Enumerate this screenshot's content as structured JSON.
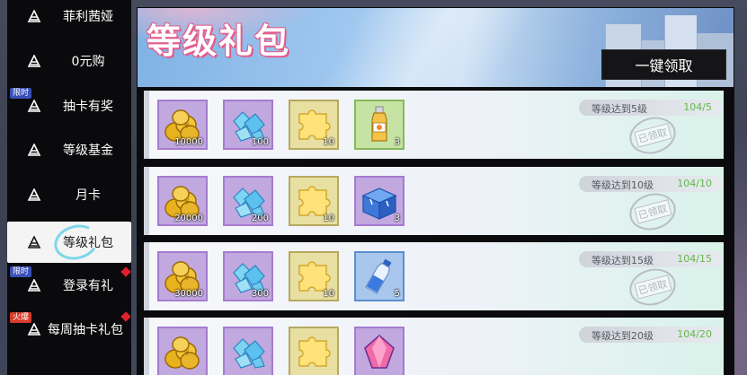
{
  "sidebar": {
    "items": [
      {
        "label": "菲利茜娅",
        "tag": "",
        "tag_color": "",
        "dot": false,
        "active": false
      },
      {
        "label": "0元购",
        "tag": "",
        "tag_color": "",
        "dot": false,
        "active": false
      },
      {
        "label": "抽卡有奖",
        "tag": "限时",
        "tag_color": "#3b4fb8",
        "dot": false,
        "active": false
      },
      {
        "label": "等级基金",
        "tag": "",
        "tag_color": "",
        "dot": false,
        "active": false
      },
      {
        "label": "月卡",
        "tag": "",
        "tag_color": "",
        "dot": false,
        "active": false
      },
      {
        "label": "等级礼包",
        "tag": "",
        "tag_color": "",
        "dot": false,
        "active": true
      },
      {
        "label": "登录有礼",
        "tag": "限时",
        "tag_color": "#3b4fb8",
        "dot": true,
        "active": false
      },
      {
        "label": "每周抽卡礼包",
        "tag": "火爆",
        "tag_color": "#d63a2a",
        "dot": true,
        "active": false
      }
    ]
  },
  "banner": {
    "title": "等级礼包",
    "claim_all_label": "一键领取"
  },
  "rows": [
    {
      "requirement": "等级达到5级",
      "progress": "104/5",
      "status": "已领取",
      "items": [
        {
          "icon": "gold-coins-icon",
          "qty": "10000",
          "rarity": "purple"
        },
        {
          "icon": "blue-crystal-icon",
          "qty": "100",
          "rarity": "purple"
        },
        {
          "icon": "puzzle-piece-icon",
          "qty": "10",
          "rarity": "gold"
        },
        {
          "icon": "juice-bottle-icon",
          "qty": "3",
          "rarity": "green"
        }
      ]
    },
    {
      "requirement": "等级达到10级",
      "progress": "104/10",
      "status": "已领取",
      "items": [
        {
          "icon": "gold-coins-icon",
          "qty": "20000",
          "rarity": "purple"
        },
        {
          "icon": "blue-crystal-icon",
          "qty": "200",
          "rarity": "purple"
        },
        {
          "icon": "puzzle-piece-icon",
          "qty": "10",
          "rarity": "gold"
        },
        {
          "icon": "gift-box-icon",
          "qty": "3",
          "rarity": "purple"
        }
      ]
    },
    {
      "requirement": "等级达到15级",
      "progress": "104/15",
      "status": "已领取",
      "items": [
        {
          "icon": "gold-coins-icon",
          "qty": "30000",
          "rarity": "purple"
        },
        {
          "icon": "blue-crystal-icon",
          "qty": "300",
          "rarity": "purple"
        },
        {
          "icon": "puzzle-piece-icon",
          "qty": "10",
          "rarity": "gold"
        },
        {
          "icon": "milk-bottle-icon",
          "qty": "5",
          "rarity": "blue"
        }
      ]
    },
    {
      "requirement": "等级达到20级",
      "progress": "104/20",
      "status": "",
      "items": [
        {
          "icon": "gold-coins-icon",
          "qty": "",
          "rarity": "purple"
        },
        {
          "icon": "blue-crystal-icon",
          "qty": "",
          "rarity": "purple"
        },
        {
          "icon": "puzzle-piece-icon",
          "qty": "",
          "rarity": "gold"
        },
        {
          "icon": "crystal-gem-icon",
          "qty": "",
          "rarity": "purple"
        }
      ]
    }
  ]
}
